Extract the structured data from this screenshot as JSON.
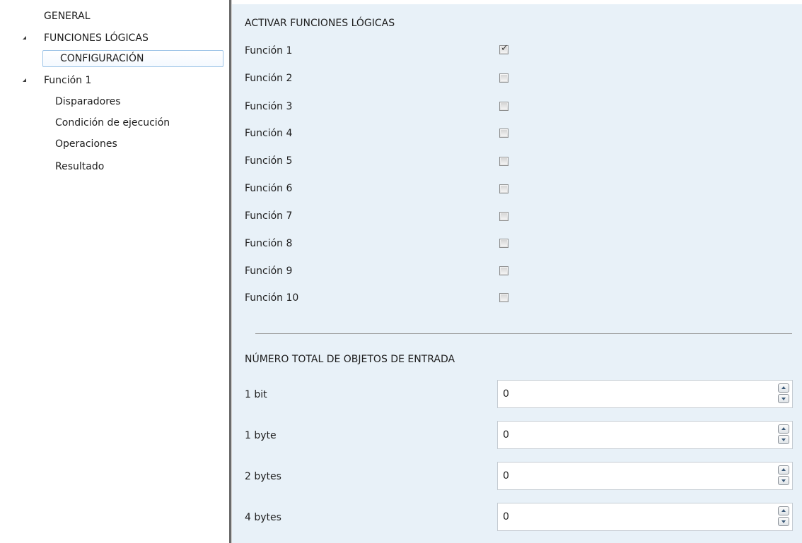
{
  "sidebar": {
    "items": [
      {
        "label": "GENERAL",
        "level": 0,
        "expanded": null
      },
      {
        "label": "FUNCIONES LÓGICAS",
        "level": 0,
        "expanded": true
      },
      {
        "label": "CONFIGURACIÓN",
        "level": 1,
        "selected": true
      },
      {
        "label": "Función 1",
        "level": 0,
        "expanded": true
      },
      {
        "label": "Disparadores",
        "level": 1
      },
      {
        "label": "Condición de ejecución",
        "level": 1
      },
      {
        "label": "Operaciones",
        "level": 1
      },
      {
        "label": "Resultado",
        "level": 1
      }
    ]
  },
  "main": {
    "activar_title": "ACTIVAR FUNCIONES LÓGICAS",
    "functions": [
      {
        "label": "Función 1",
        "checked": true
      },
      {
        "label": "Función 2",
        "checked": false
      },
      {
        "label": "Función 3",
        "checked": false
      },
      {
        "label": "Función 4",
        "checked": false
      },
      {
        "label": "Función 5",
        "checked": false
      },
      {
        "label": "Función 6",
        "checked": false
      },
      {
        "label": "Función 7",
        "checked": false
      },
      {
        "label": "Función 8",
        "checked": false
      },
      {
        "label": "Función 9",
        "checked": false
      },
      {
        "label": "Función 10",
        "checked": false
      }
    ],
    "objetos_title": "NÚMERO TOTAL DE OBJETOS DE ENTRADA",
    "inputs": [
      {
        "label": "1 bit",
        "value": "0"
      },
      {
        "label": "1 byte",
        "value": "0"
      },
      {
        "label": "2 bytes",
        "value": "0"
      },
      {
        "label": "4 bytes",
        "value": "0"
      }
    ]
  },
  "colors": {
    "panel_bg": "#e8f1f8",
    "selection_border": "#9fc5e8",
    "splitter": "#6b6b6b"
  }
}
